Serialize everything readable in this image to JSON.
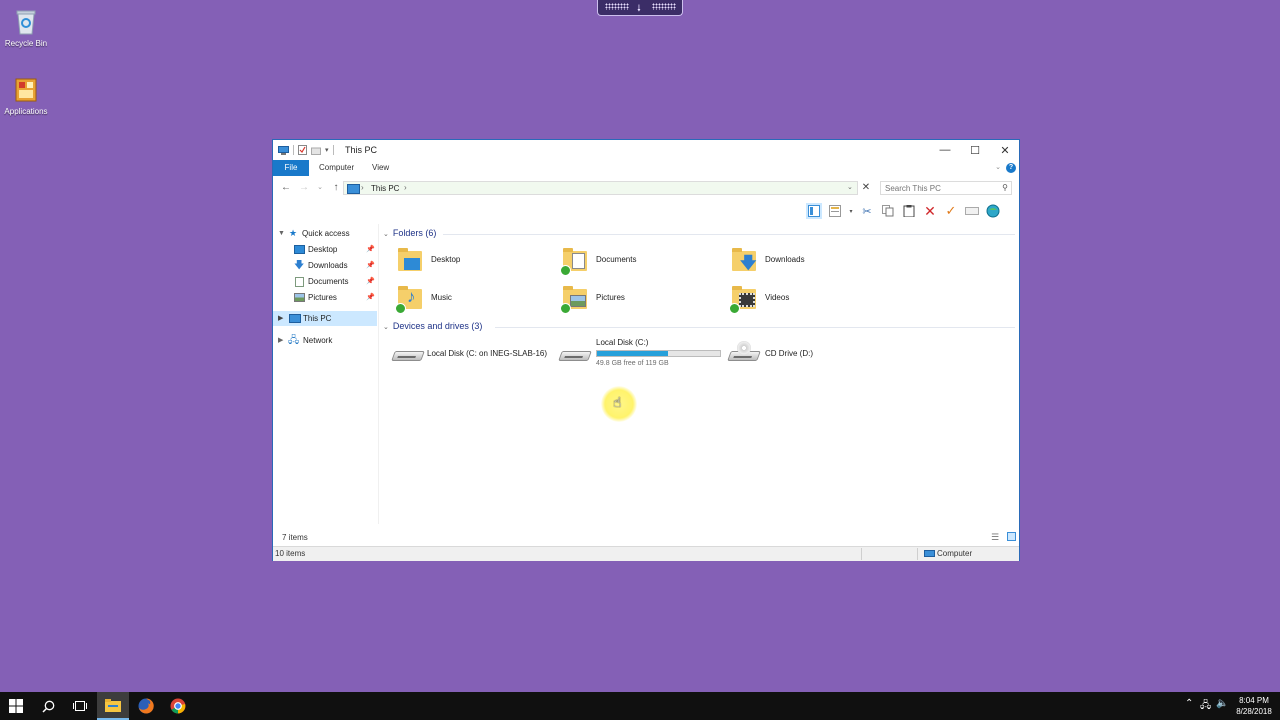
{
  "desktop": {
    "icons": [
      {
        "label": "Recycle Bin",
        "icon": "recycle-bin-icon"
      },
      {
        "label": "Applications",
        "icon": "applications-icon"
      }
    ]
  },
  "window": {
    "title": "This PC",
    "ribbon_tabs": [
      "File",
      "Computer",
      "View"
    ],
    "address": {
      "crumb": "This PC"
    },
    "search": {
      "placeholder": "Search This PC"
    },
    "nav": {
      "quick_access": "Quick access",
      "items": [
        "Desktop",
        "Downloads",
        "Documents",
        "Pictures"
      ],
      "this_pc": "This PC",
      "network": "Network"
    },
    "folders": {
      "header": "Folders (6)",
      "items": [
        "Desktop",
        "Documents",
        "Downloads",
        "Music",
        "Pictures",
        "Videos"
      ]
    },
    "drives": {
      "header": "Devices and drives (3)",
      "items": [
        {
          "name": "Local Disk (C: on INEG-SLAB-16)"
        },
        {
          "name": "Local Disk (C:)",
          "free_text": "49.8 GB free of 119 GB",
          "used_fraction": 0.58
        },
        {
          "name": "CD Drive (D:)"
        }
      ]
    },
    "status": {
      "items_count": "7 items",
      "bottom_count": "10 items",
      "location": "Computer"
    }
  },
  "taskbar": {
    "clock_time": "8:04 PM",
    "clock_date": "8/28/2018"
  },
  "colors": {
    "desktop": "#8460b6",
    "accent": "#1979ca",
    "usage_bar": "#26a0da",
    "selected": "#cce8ff"
  }
}
